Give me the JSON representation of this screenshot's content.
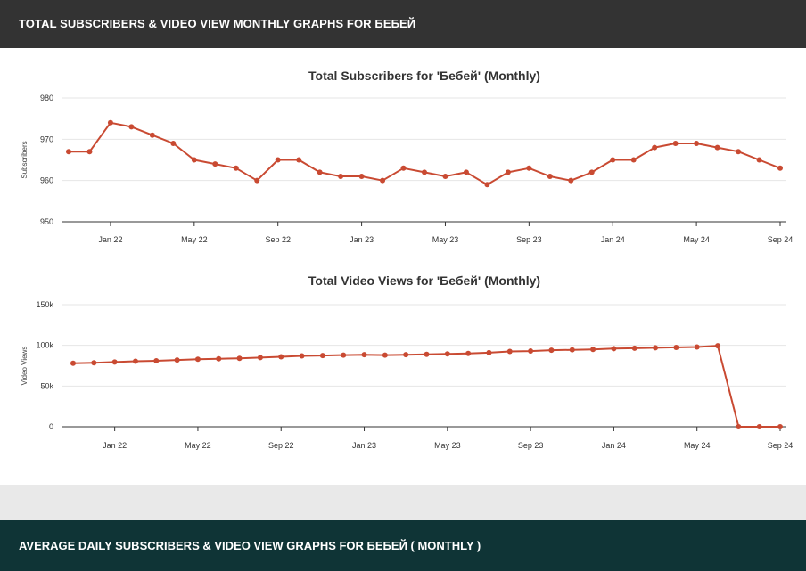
{
  "header": {
    "title": "TOTAL SUBSCRIBERS & VIDEO VIEW MONTHLY GRAPHS FOR БЕБЕЙ"
  },
  "footer": {
    "title": "AVERAGE DAILY SUBSCRIBERS & VIDEO VIEW GRAPHS FOR БЕБЕЙ ( MONTHLY )"
  },
  "colors": {
    "line": "#c94a32",
    "grid": "#e6e6e6",
    "axis": "#333333"
  },
  "chart_data": [
    {
      "type": "line",
      "title": "Total Subscribers for 'Бебей' (Monthly)",
      "ylabel": "Subscribers",
      "xlabel": "",
      "ylim": [
        950,
        980
      ],
      "y_ticks": [
        "950",
        "960",
        "970",
        "980"
      ],
      "y_tick_values": [
        950,
        960,
        970,
        980
      ],
      "x_tick_labels": [
        "Jan 22",
        "May 22",
        "Sep 22",
        "Jan 23",
        "May 23",
        "Sep 23",
        "Jan 24",
        "May 24",
        "Sep 24"
      ],
      "x_tick_months": [
        2,
        6,
        10,
        14,
        18,
        22,
        26,
        30,
        34
      ],
      "x_months": [
        0,
        1,
        2,
        3,
        4,
        5,
        6,
        7,
        8,
        9,
        10,
        11,
        12,
        13,
        14,
        15,
        16,
        17,
        18,
        19,
        20,
        21,
        22,
        23,
        24,
        25,
        26,
        27,
        28,
        29,
        30,
        31,
        32,
        33,
        34
      ],
      "values": [
        967,
        967,
        974,
        973,
        971,
        969,
        965,
        964,
        963,
        960,
        965,
        965,
        962,
        961,
        961,
        960,
        963,
        962,
        961,
        962,
        959,
        962,
        963,
        961,
        960,
        962,
        965,
        965,
        968,
        969,
        969,
        968,
        967,
        965,
        963
      ],
      "grid": true,
      "legend": "none"
    },
    {
      "type": "line",
      "title": "Total Video Views for 'Бебей' (Monthly)",
      "ylabel": "Video Views",
      "xlabel": "",
      "ylim": [
        0,
        150000
      ],
      "y_ticks": [
        "0",
        "50k",
        "100k",
        "150k"
      ],
      "y_tick_values": [
        0,
        50000,
        100000,
        150000
      ],
      "x_tick_labels": [
        "Jan 22",
        "May 22",
        "Sep 22",
        "Jan 23",
        "May 23",
        "Sep 23",
        "Jan 24",
        "May 24",
        "Sep 24"
      ],
      "x_tick_months": [
        2,
        6,
        10,
        14,
        18,
        22,
        26,
        30,
        34
      ],
      "x_months": [
        0,
        1,
        2,
        3,
        4,
        5,
        6,
        7,
        8,
        9,
        10,
        11,
        12,
        13,
        14,
        15,
        16,
        17,
        18,
        19,
        20,
        21,
        22,
        23,
        24,
        25,
        26,
        27,
        28,
        29,
        30,
        31,
        32,
        33,
        34
      ],
      "values": [
        78000,
        78500,
        79500,
        80500,
        81000,
        82000,
        83000,
        83500,
        84000,
        85000,
        86000,
        87000,
        87500,
        88000,
        88500,
        88000,
        88500,
        89000,
        89500,
        90000,
        91000,
        92500,
        93000,
        94000,
        94500,
        95000,
        96000,
        96500,
        97000,
        97500,
        98000,
        99500,
        0,
        0,
        0
      ],
      "grid": true,
      "legend": "none"
    }
  ]
}
